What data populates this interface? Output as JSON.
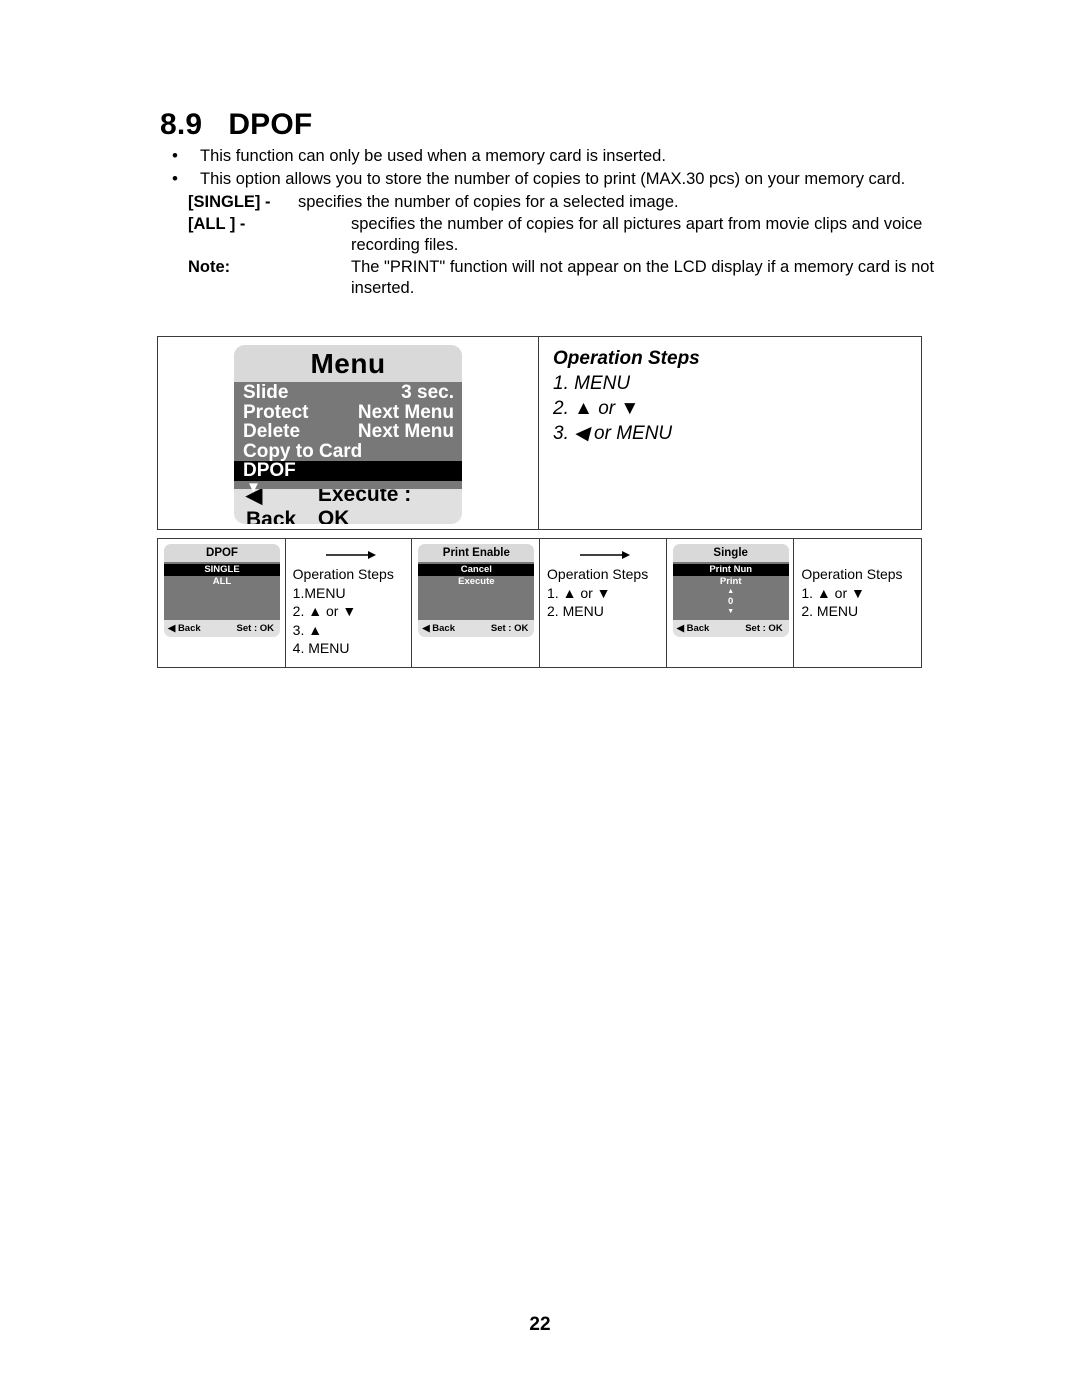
{
  "document": {
    "page_number": "22"
  },
  "heading": {
    "number": "8.9",
    "title": "DPOF"
  },
  "body": {
    "bullets": [
      "This function can only be used when a memory card is inserted.",
      "This option allows you to store the number of copies to print (MAX.30 pcs) on your memory card."
    ],
    "bullet_glyph": "•",
    "definitions": [
      {
        "term": "[SINGLE] -",
        "desc": "specifies the number of copies for a selected image."
      },
      {
        "term": "[ALL ] -",
        "desc": "specifies the number of copies for all pictures apart from movie clips and voice recording files."
      },
      {
        "term": "Note:",
        "desc": "The \"PRINT\" function will not appear on the LCD display if a memory card is not inserted."
      }
    ]
  },
  "glyphs": {
    "up": "▲",
    "down": "▼",
    "left": "◀",
    "bullet": "•"
  },
  "top_table": {
    "lcd": {
      "title": "Menu",
      "rows": [
        {
          "label": "Slide",
          "value": "3 sec.",
          "selected": false
        },
        {
          "label": "Protect",
          "value": "Next Menu",
          "selected": false
        },
        {
          "label": "Delete",
          "value": "Next Menu",
          "selected": false
        },
        {
          "label": "Copy to Card",
          "value": "",
          "selected": false
        },
        {
          "label": "DPOF",
          "value": "",
          "selected": true
        }
      ],
      "scroll_caret": "▼",
      "footer_left": "◀ Back",
      "footer_right": "Execute : OK"
    },
    "steps": {
      "title": "Operation Steps",
      "lines": [
        "1. MENU",
        "2. ▲ or ▼",
        "3. ◀ or MENU"
      ]
    }
  },
  "bottom_table": {
    "panels": [
      {
        "title": "DPOF",
        "options": [
          {
            "label": "SINGLE",
            "selected": true
          },
          {
            "label": "ALL",
            "selected": false
          }
        ],
        "spinner": null,
        "footer_left": "◀ Back",
        "footer_right": "Set : OK"
      },
      {
        "title": "Print Enable",
        "options": [
          {
            "label": "Cancel",
            "selected": true
          },
          {
            "label": "Execute",
            "selected": false
          }
        ],
        "spinner": null,
        "footer_left": "◀ Back",
        "footer_right": "Set : OK"
      },
      {
        "title": "Single",
        "options": [
          {
            "label": "Print Nun",
            "selected": true
          },
          {
            "label": "Print",
            "selected": false
          }
        ],
        "spinner": {
          "up": "▲",
          "value": "0",
          "down": "▼"
        },
        "footer_left": "◀ Back",
        "footer_right": "Set : OK"
      }
    ],
    "steps": [
      {
        "title": "Operation Steps",
        "has_flow_arrow": true,
        "lines": [
          "1.MENU",
          "2. ▲ or ▼",
          "3. ▲",
          "4. MENU"
        ]
      },
      {
        "title": "Operation Steps",
        "has_flow_arrow": true,
        "lines": [
          "1. ▲ or ▼",
          "2. MENU"
        ]
      },
      {
        "title": "Operation Steps",
        "has_flow_arrow": false,
        "lines": [
          "1. ▲ or ▼",
          "2. MENU"
        ]
      }
    ]
  },
  "colors": {
    "lcd_title_bg": "#d9d9d9",
    "lcd_body_bg": "#787878",
    "lcd_footer_bg": "#e0e0e0",
    "lcd_selected_bg": "#000000",
    "border": "#3b3b3b",
    "text": "#000000"
  }
}
